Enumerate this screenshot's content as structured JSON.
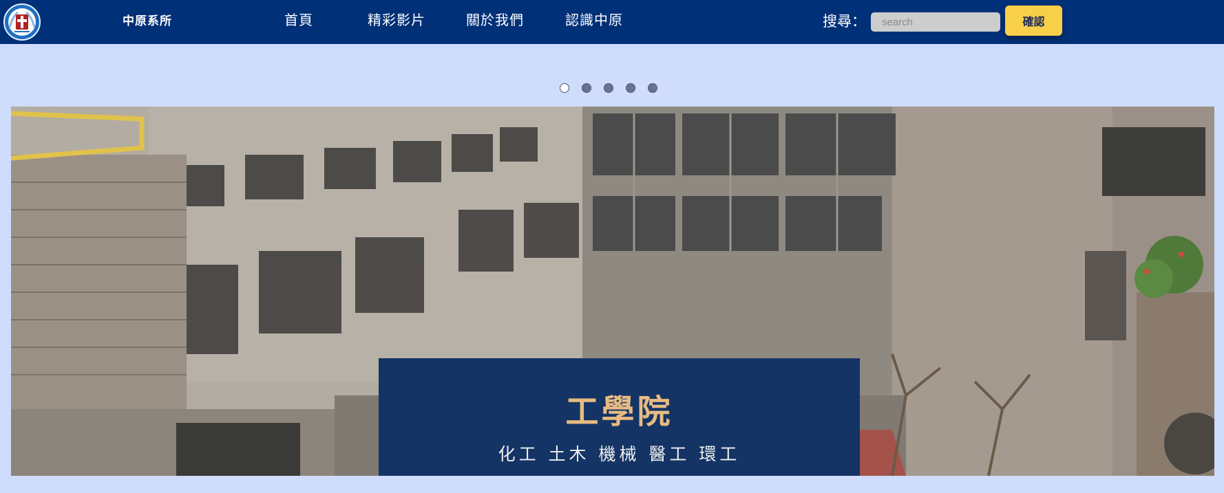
{
  "colors": {
    "navbar_bg": "#003078",
    "page_bg": "#cfdcfc",
    "button_bg": "#f7cf49",
    "caption_bg": "#143465",
    "caption_title": "#e7bb82"
  },
  "header": {
    "logo_icon": "university-emblem-icon",
    "brand": "中原系所",
    "nav": [
      {
        "label": "首頁"
      },
      {
        "label": "精彩影片"
      },
      {
        "label": "關於我們"
      },
      {
        "label": "認識中原"
      }
    ],
    "search": {
      "label": "搜尋：",
      "placeholder": "search",
      "value": "",
      "button_label": "確認"
    }
  },
  "carousel": {
    "indicators": [
      "slide-1",
      "slide-2",
      "slide-3",
      "slide-4",
      "slide-5"
    ],
    "active_index": 0,
    "slide": {
      "title": "工學院",
      "subtitle": "化工 土木 機械 醫工 環工",
      "image_icon": "campus-courtyard-photo"
    }
  }
}
